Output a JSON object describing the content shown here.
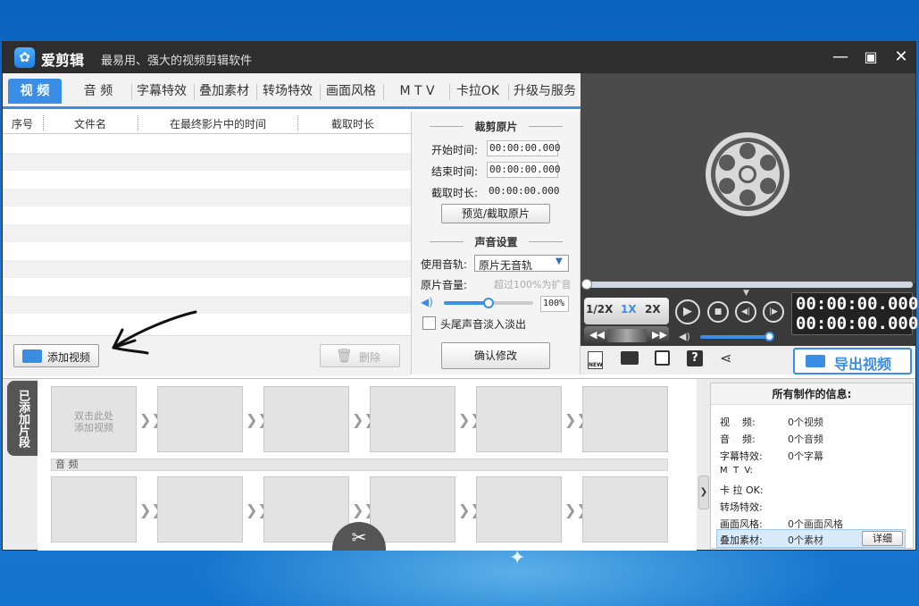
{
  "app": {
    "name": "爱剪辑",
    "slogan": "最易用、强大的视频剪辑软件"
  },
  "window_controls": {
    "minimize": "—",
    "maximize": "▣",
    "close": "✕"
  },
  "tabs": [
    {
      "label": "视 频"
    },
    {
      "label": "音 频"
    },
    {
      "label": "字幕特效"
    },
    {
      "label": "叠加素材"
    },
    {
      "label": "转场特效"
    },
    {
      "label": "画面风格"
    },
    {
      "label": "M T V"
    },
    {
      "label": "卡拉OK"
    },
    {
      "label": "升级与服务"
    }
  ],
  "active_tab": "视 频",
  "list": {
    "columns": [
      "序号",
      "文件名",
      "在最终影片中的时间",
      "截取时长"
    ],
    "rows": []
  },
  "buttons": {
    "add_video": "添加视频",
    "delete": "删除",
    "preview_clip": "预览/截取原片",
    "confirm": "确认修改",
    "export": "导出视频",
    "detail": "详细"
  },
  "clip": {
    "section_title": "裁剪原片",
    "start_label": "开始时间:",
    "start_value": "00:00:00.000",
    "end_label": "结束时间:",
    "end_value": "00:00:00.000",
    "duration_label": "截取时长:",
    "duration_value": "00:00:00.000"
  },
  "sound": {
    "section_title": "声音设置",
    "track_label": "使用音轨:",
    "track_value": "原片无音轨",
    "volume_label": "原片音量:",
    "volume_hint": "超过100%为扩音",
    "volume_value": "100%",
    "volume_fraction": 0.5,
    "fade_label": "头尾声音淡入淡出",
    "fade_checked": false
  },
  "player": {
    "time_current": "00:00:00.000",
    "time_total": "00:00:00.000",
    "speeds": [
      "1/2X",
      "1X",
      "2X"
    ],
    "active_speed": "1X",
    "progress_fraction": 0,
    "volume_fraction": 1.0
  },
  "timeline": {
    "side_label": "已添加片段",
    "placeholder_line1": "双击此处",
    "placeholder_line2": "添加视频",
    "audio_label": "音 频"
  },
  "info": {
    "title": "所有制作的信息:",
    "items": [
      {
        "k": "视    频:",
        "v": "0个视频"
      },
      {
        "k": "音    频:",
        "v": "0个音频"
      },
      {
        "k": "字幕特效:",
        "v": "0个字幕"
      },
      {
        "k": "M  T  V:",
        "v": ""
      },
      {
        "k": "卡 拉 OK:",
        "v": ""
      },
      {
        "k": "转场特效:",
        "v": ""
      },
      {
        "k": "画面风格:",
        "v": "0个画面风格"
      },
      {
        "k": "叠加素材:",
        "v": "0个素材"
      }
    ]
  },
  "colors": {
    "accent": "#3a8ee6",
    "titlebar": "#2e2e2e",
    "player_bg": "#474747",
    "desktop": "#1670c9"
  }
}
